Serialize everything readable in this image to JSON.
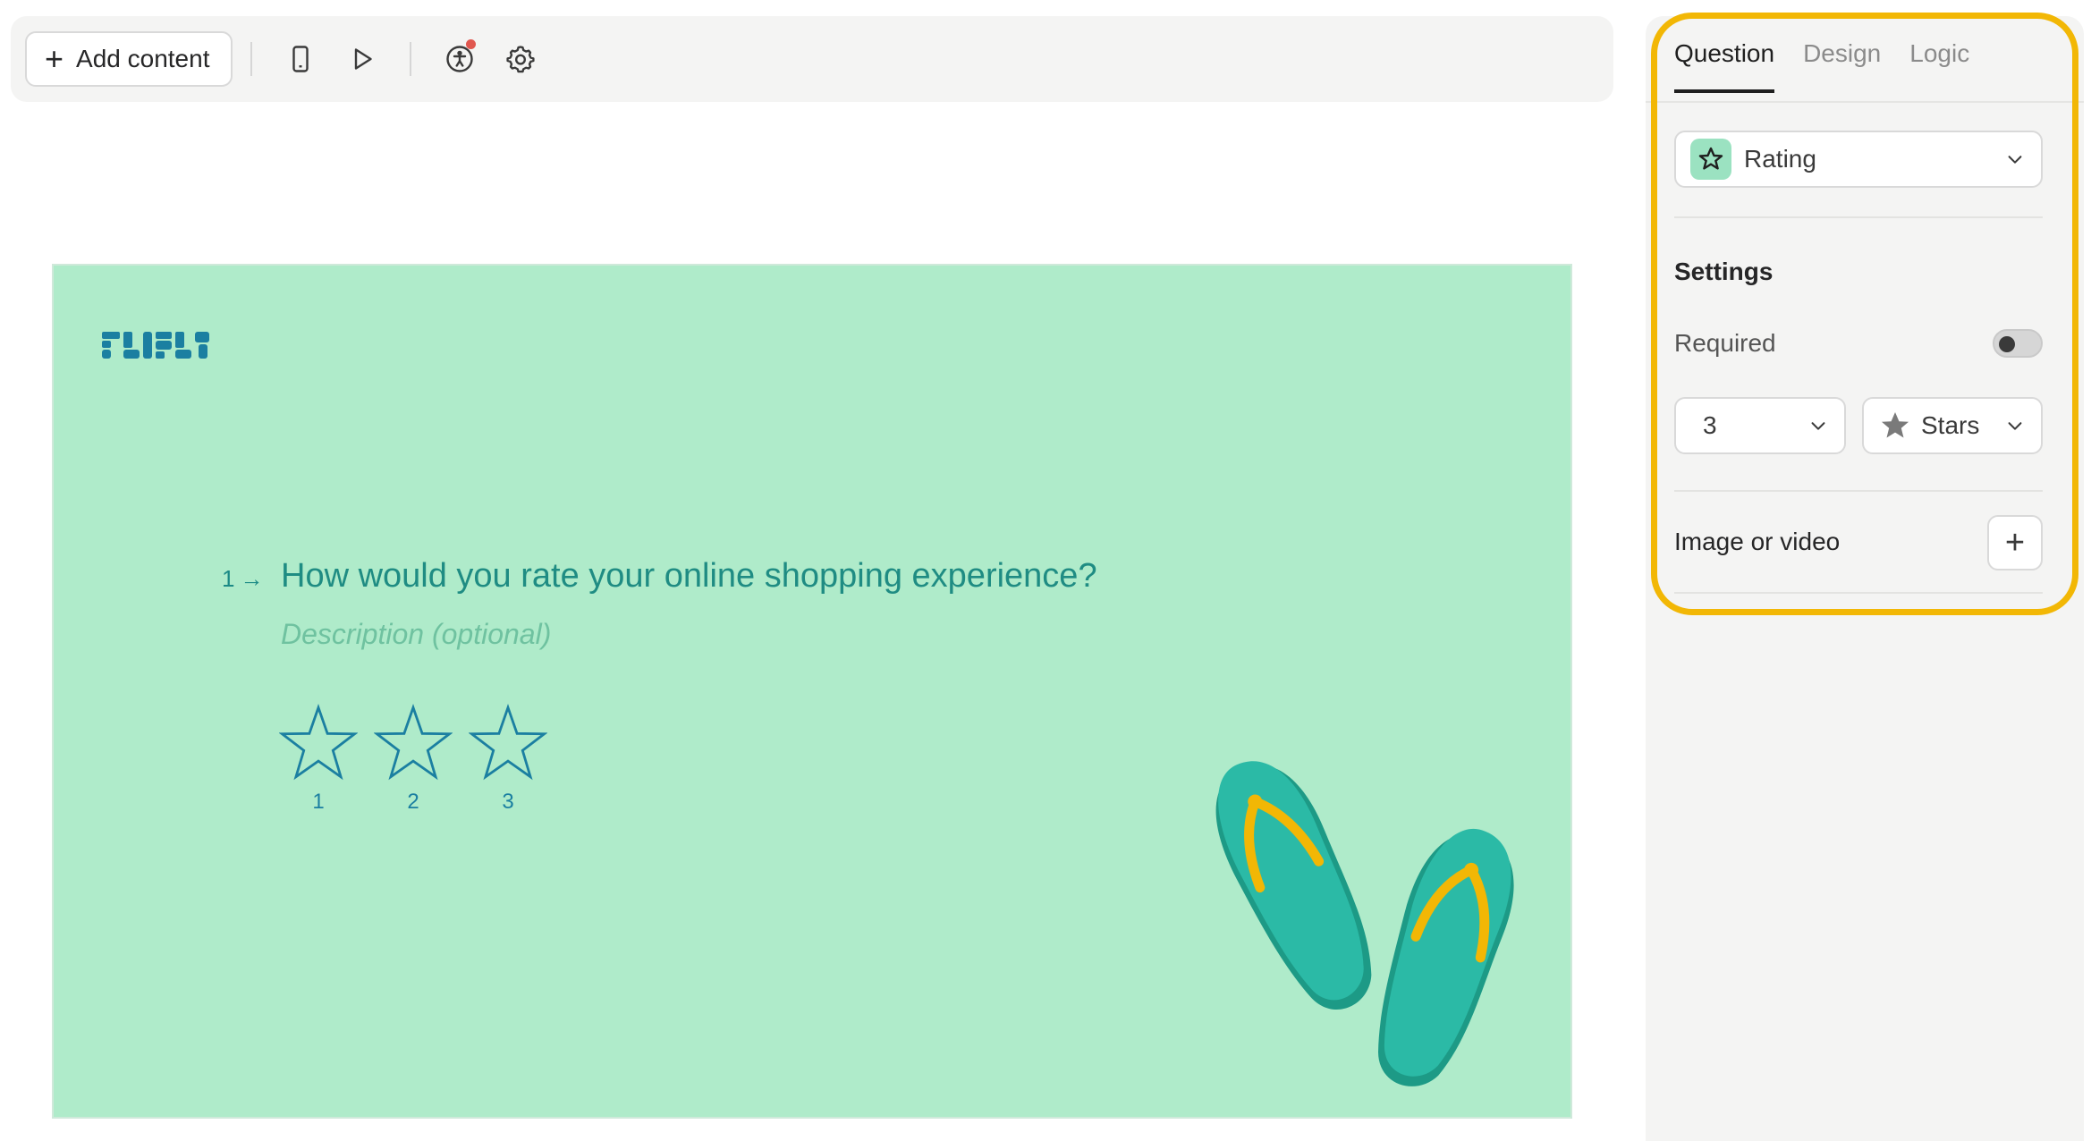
{
  "toolbar": {
    "add_content_label": "Add content",
    "plus_symbol": "+",
    "icons": [
      "mobile-preview-icon",
      "play-icon",
      "accessibility-icon",
      "gear-icon"
    ]
  },
  "canvas": {
    "background": "#afebca",
    "question": {
      "number": "1",
      "arrow": "→",
      "title": "How would you rate your online shopping experience?",
      "description_placeholder": "Description (optional)"
    },
    "rating": {
      "steps": [
        "1",
        "2",
        "3"
      ]
    }
  },
  "panel": {
    "tabs": [
      {
        "label": "Question",
        "active": true
      },
      {
        "label": "Design",
        "active": false
      },
      {
        "label": "Logic",
        "active": false
      }
    ],
    "question_type": "Rating",
    "settings_title": "Settings",
    "required_label": "Required",
    "required_on": false,
    "count_value": "3",
    "shape_value": "Stars",
    "media_label": "Image or video",
    "media_add_symbol": "+",
    "highlight_color": "#f2b705"
  }
}
